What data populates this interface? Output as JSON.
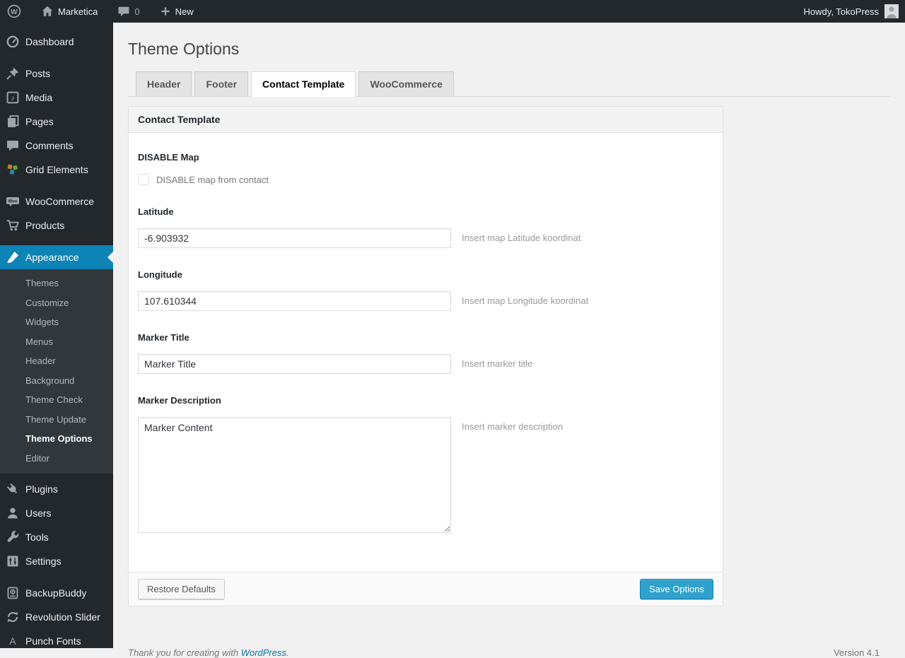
{
  "admin_bar": {
    "site_name": "Marketica",
    "comments_count": "0",
    "new_label": "New",
    "howdy": "Howdy, TokoPress"
  },
  "icons": {
    "wp_logo_letter": "W",
    "media_note": "♪",
    "woo_badge": "Woo",
    "punch_fonts_letter": "A"
  },
  "sidebar": {
    "items": [
      {
        "label": "Dashboard",
        "icon": "dashboard-icon"
      },
      {
        "label": "Posts",
        "icon": "pushpin-icon"
      },
      {
        "label": "Media",
        "icon": "media-icon"
      },
      {
        "label": "Pages",
        "icon": "pages-icon"
      },
      {
        "label": "Comments",
        "icon": "comment-icon"
      },
      {
        "label": "Grid Elements",
        "icon": "grid-elements-icon"
      },
      {
        "label": "WooCommerce",
        "icon": "woocommerce-icon"
      },
      {
        "label": "Products",
        "icon": "cart-icon"
      },
      {
        "label": "Appearance",
        "icon": "brush-icon",
        "active": true
      },
      {
        "label": "Plugins",
        "icon": "plug-icon"
      },
      {
        "label": "Users",
        "icon": "user-icon"
      },
      {
        "label": "Tools",
        "icon": "wrench-icon"
      },
      {
        "label": "Settings",
        "icon": "sliders-icon"
      },
      {
        "label": "BackupBuddy",
        "icon": "backup-icon"
      },
      {
        "label": "Revolution Slider",
        "icon": "refresh-icon"
      },
      {
        "label": "Punch Fonts",
        "icon": "letter-a-icon"
      }
    ],
    "appearance_submenu": {
      "items": [
        "Themes",
        "Customize",
        "Widgets",
        "Menus",
        "Header",
        "Background",
        "Theme Check",
        "Theme Update",
        "Theme Options",
        "Editor"
      ],
      "current": "Theme Options"
    }
  },
  "main": {
    "title": "Theme Options",
    "tabs": [
      {
        "label": "Header",
        "active": false
      },
      {
        "label": "Footer",
        "active": false
      },
      {
        "label": "Contact Template",
        "active": true
      },
      {
        "label": "WooCommerce",
        "active": false
      }
    ],
    "panel": {
      "header": "Contact Template",
      "disable_map": {
        "label": "DISABLE Map",
        "checkbox_label": "DISABLE map from contact",
        "checked": false
      },
      "latitude": {
        "label": "Latitude",
        "value": "-6.903932",
        "help": "Insert map Latitude koordinat"
      },
      "longitude": {
        "label": "Longitude",
        "value": "107.610344",
        "help": "Insert map Longitude koordinat"
      },
      "marker_title": {
        "label": "Marker Title",
        "value": "Marker Title",
        "help": "Insert marker title"
      },
      "marker_description": {
        "label": "Marker Description",
        "value": "Marker Content",
        "help": "Insert marker description"
      },
      "restore_button": "Restore Defaults",
      "save_button": "Save Options"
    }
  },
  "footer": {
    "thanks_text": "Thank you for creating with",
    "link_text": "WordPress",
    "period": ".",
    "version": "Version 4.1"
  },
  "colors": {
    "admin_dark": "#23282d",
    "submenu_bg": "#32373c",
    "active_menu_blue": "#0e83b5",
    "primary_button_blue": "#2ea2cc",
    "link_blue": "#0074a2",
    "page_bg": "#f1f1f1"
  }
}
